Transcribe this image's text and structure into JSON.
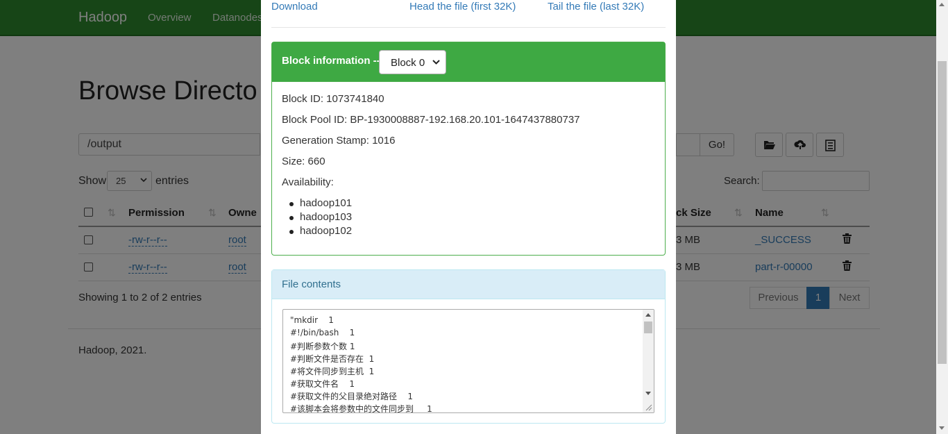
{
  "navbar": {
    "brand": "Hadoop",
    "links": [
      "Overview",
      "Datanodes"
    ]
  },
  "page": {
    "title": "Browse Directo",
    "path_value": "/output",
    "go_label": "Go!",
    "show_label": "Show",
    "entries_value": "25",
    "entries_label": "entries",
    "search_label": "Search:",
    "showing_text": "Showing 1 to 2 of 2 entries",
    "footer": "Hadoop, 2021.",
    "pagination": {
      "previous": "Previous",
      "current": "1",
      "next": "Next"
    }
  },
  "table": {
    "headers": {
      "permission": "Permission",
      "owner": "Owne",
      "block_size": "ck Size",
      "name": "Name"
    },
    "rows": [
      {
        "permission": "-rw-r--r--",
        "owner": "root",
        "block_size": "3 MB",
        "name": "_SUCCESS"
      },
      {
        "permission": "-rw-r--r--",
        "owner": "root",
        "block_size": "3 MB",
        "name": "part-r-00000"
      }
    ]
  },
  "modal": {
    "links": {
      "download": "Download",
      "head": "Head the file (first 32K)",
      "tail": "Tail the file (last 32K)"
    },
    "block_panel": {
      "title": "Block information --",
      "selected_block": "Block 0",
      "block_id": "Block ID: 1073741840",
      "block_pool_id": "Block Pool ID: BP-1930008887-192.168.20.101-1647437880737",
      "generation_stamp": "Generation Stamp: 1016",
      "size": "Size: 660",
      "availability_label": "Availability:",
      "availability": [
        "hadoop101",
        "hadoop103",
        "hadoop102"
      ]
    },
    "file_panel": {
      "title": "File contents",
      "lines": [
        "\"mkdir    1",
        "#!/bin/bash    1",
        "#判断参数个数 1",
        "#判断文件是否存在  1",
        "#将文件同步到主机  1",
        "#获取文件名    1",
        "#获取文件的父目录绝对路径    1",
        "#该脚本会将参数中的文件同步到     1"
      ]
    }
  },
  "colors": {
    "navbar": "#2e8b2e",
    "block_header": "#3ea943",
    "file_header": "#d9edf7",
    "link": "#337ab7"
  }
}
